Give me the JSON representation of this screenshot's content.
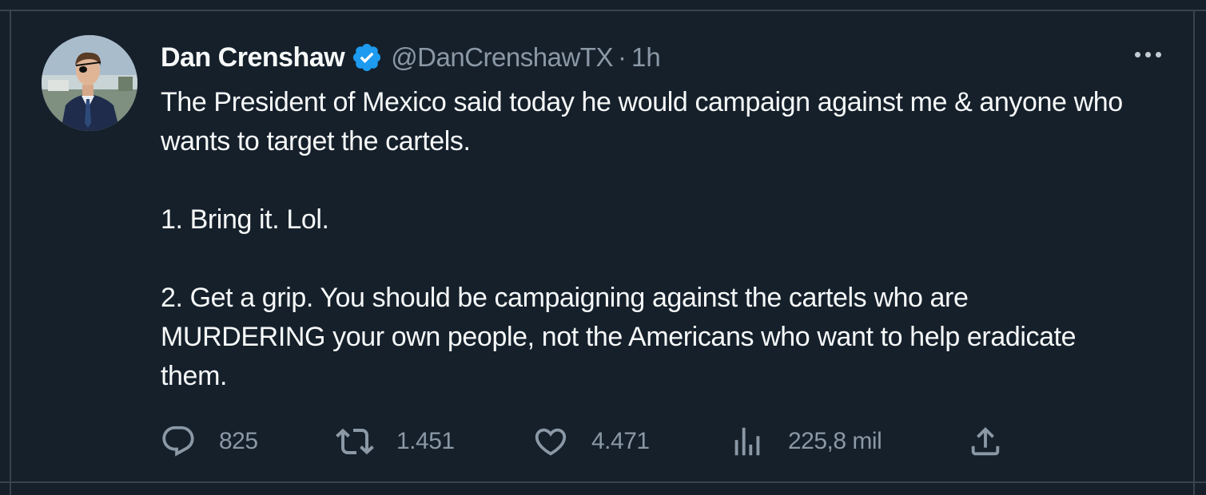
{
  "tweet": {
    "author": {
      "name": "Dan Crenshaw",
      "handle": "@DanCrenshawTX",
      "verified": true
    },
    "separator": "·",
    "time": "1h",
    "paragraphs": [
      "The President of Mexico said today he would campaign against me & anyone who wants to target the cartels.",
      "1. Bring it. Lol.",
      "2. Get a grip. You should be campaigning against the cartels who are MURDERING your own people, not the Americans who want to help eradicate them."
    ],
    "actions": {
      "replies": "825",
      "retweets": "1.451",
      "likes": "4.471",
      "views": "225,8 mil"
    }
  },
  "colors": {
    "background": "#15202b",
    "border": "#38444d",
    "text_primary": "#f7f9f9",
    "text_secondary": "#8b98a5",
    "verified_badge": "#1d9bf0"
  },
  "icons": {
    "more": "more-dots-icon",
    "verified": "verified-badge-icon",
    "reply": "reply-icon",
    "retweet": "retweet-icon",
    "like": "heart-icon",
    "views": "analytics-icon",
    "share": "share-icon"
  }
}
